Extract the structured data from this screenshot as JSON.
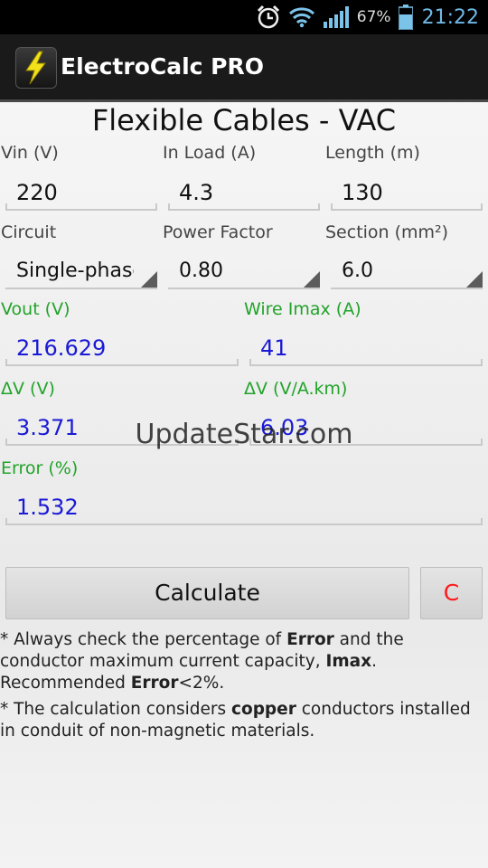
{
  "status_bar": {
    "battery_percent": "67%",
    "time": "21:22",
    "icons": [
      "alarm-icon",
      "wifi-icon",
      "signal-icon",
      "battery-icon"
    ]
  },
  "app_bar": {
    "title": "ElectroCalc PRO",
    "icon": "lightning-bolt-icon"
  },
  "page_title": "Flexible Cables - VAC",
  "inputs": {
    "vin": {
      "label": "Vin (V)",
      "value": "220"
    },
    "in_load": {
      "label": "In Load (A)",
      "value": "4.3"
    },
    "length": {
      "label": "Length (m)",
      "value": "130"
    }
  },
  "selects": {
    "circuit": {
      "label": "Circuit",
      "value": "Single-phase"
    },
    "power_factor": {
      "label": "Power Factor",
      "value": "0.80"
    },
    "section": {
      "label": "Section (mm²)",
      "value": "6.0"
    }
  },
  "results": {
    "vout": {
      "label": "Vout (V)",
      "value": "216.629"
    },
    "wire_imax": {
      "label": "Wire Imax (A)",
      "value": "41"
    },
    "delta_v": {
      "label": "ΔV (V)",
      "value": "3.371"
    },
    "delta_v_akm": {
      "label": "ΔV (V/A.km)",
      "value": "6.03"
    },
    "error": {
      "label": "Error (%)",
      "value": "1.532"
    }
  },
  "buttons": {
    "calculate": "Calculate",
    "clear": "C"
  },
  "notes": {
    "note1": {
      "bullet": "*",
      "p1": " Always check the percentage of ",
      "b1": "Error",
      "p2": " and the conductor maximum current capacity, ",
      "b2": "Imax",
      "p3": ". Recommended ",
      "b3": "Error",
      "p4": "<2%."
    },
    "note2": {
      "bullet": "*",
      "p1": " The calculation considers ",
      "b1": "copper",
      "p2": " conductors installed in conduit of non-magnetic materials."
    }
  },
  "watermark": "UpdateStar.com",
  "colors": {
    "accent_green": "#21a329",
    "result_blue": "#1a1ad6",
    "clear_red": "#ff1a1a",
    "status_time": "#6fb8e6"
  }
}
